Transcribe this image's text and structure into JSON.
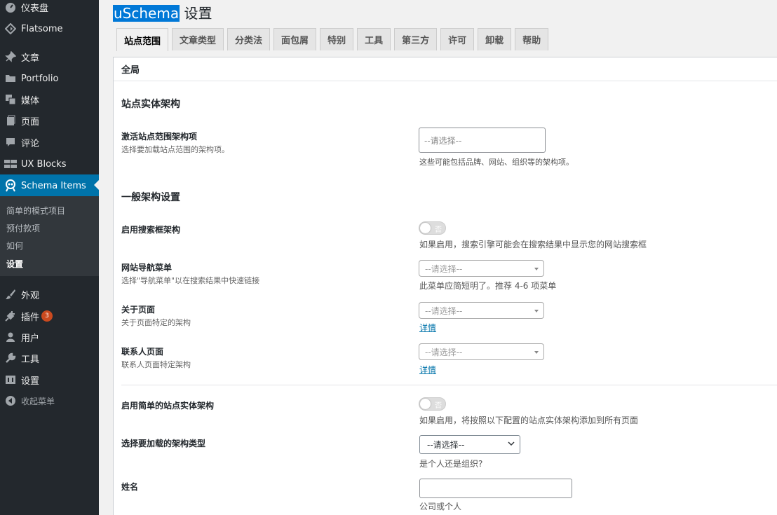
{
  "sidebar": {
    "items": [
      {
        "label": "仪表盘",
        "icon": "dashboard-icon"
      },
      {
        "label": "Flatsome",
        "icon": "flatsome-icon"
      },
      {
        "label": "文章",
        "icon": "pin-icon"
      },
      {
        "label": "Portfolio",
        "icon": "folder-icon"
      },
      {
        "label": "媒体",
        "icon": "media-icon"
      },
      {
        "label": "页面",
        "icon": "page-icon"
      },
      {
        "label": "评论",
        "icon": "comment-icon"
      },
      {
        "label": "UX Blocks",
        "icon": "grid-icon"
      },
      {
        "label": "Schema Items",
        "icon": "schema-icon"
      }
    ],
    "submenu": [
      "简单的模式项目",
      "预付款项",
      "如何",
      "设置"
    ],
    "lower_items": [
      {
        "label": "外观",
        "icon": "brush-icon"
      },
      {
        "label": "插件",
        "icon": "plugin-icon",
        "badge": "3"
      },
      {
        "label": "用户",
        "icon": "user-icon"
      },
      {
        "label": "工具",
        "icon": "wrench-icon"
      },
      {
        "label": "设置",
        "icon": "settings-icon"
      },
      {
        "label": "收起菜单",
        "icon": "collapse-icon"
      }
    ]
  },
  "header": {
    "title_highlight": "uSchema",
    "title_rest": " 设置"
  },
  "tabs": [
    "站点范围",
    "文章类型",
    "分类法",
    "面包屑",
    "特别",
    "工具",
    "第三方",
    "许可",
    "卸载",
    "帮助"
  ],
  "panel": {
    "heading": "全局",
    "section1": {
      "title": "站点实体架构",
      "field1": {
        "label": "激活站点范围架构项",
        "desc": "选择要加载站点范围的架构项。",
        "placeholder": "--请选择--",
        "hint": "这些可能包括品牌、网站、组织等的架构项。"
      }
    },
    "section2": {
      "title": "一般架构设置",
      "search": {
        "label": "启用搜索框架构",
        "toggle": "否",
        "hint": "如果启用，搜索引擎可能会在搜索结果中显示您的网站搜索框"
      },
      "nav": {
        "label": "网站导航菜单",
        "desc": "选择\"导航菜单\"以在搜索结果中快速链接",
        "placeholder": "--请选择--",
        "hint": "此菜单应简短明了。推荐 4-6 项菜单"
      },
      "about": {
        "label": "关于页面",
        "desc": "关于页面特定的架构",
        "placeholder": "--请选择--",
        "link": "详情"
      },
      "contact": {
        "label": "联系人页面",
        "desc": "联系人页面特定架构",
        "placeholder": "--请选择--",
        "link": "详情"
      }
    },
    "section3": {
      "simple": {
        "label": "启用简单的站点实体架构",
        "toggle": "否",
        "hint": "如果启用，将按照以下配置的站点实体架构添加到所有页面"
      },
      "type": {
        "label": "选择要加载的架构类型",
        "value": "--请选择--",
        "hint": "是个人还是组织?"
      },
      "name": {
        "label": "姓名",
        "hint": "公司或个人"
      }
    }
  },
  "colors": {
    "sidebar_bg": "#23282d",
    "active_bg": "#0073aa",
    "link": "#0073aa",
    "badge": "#ca4a1f"
  }
}
